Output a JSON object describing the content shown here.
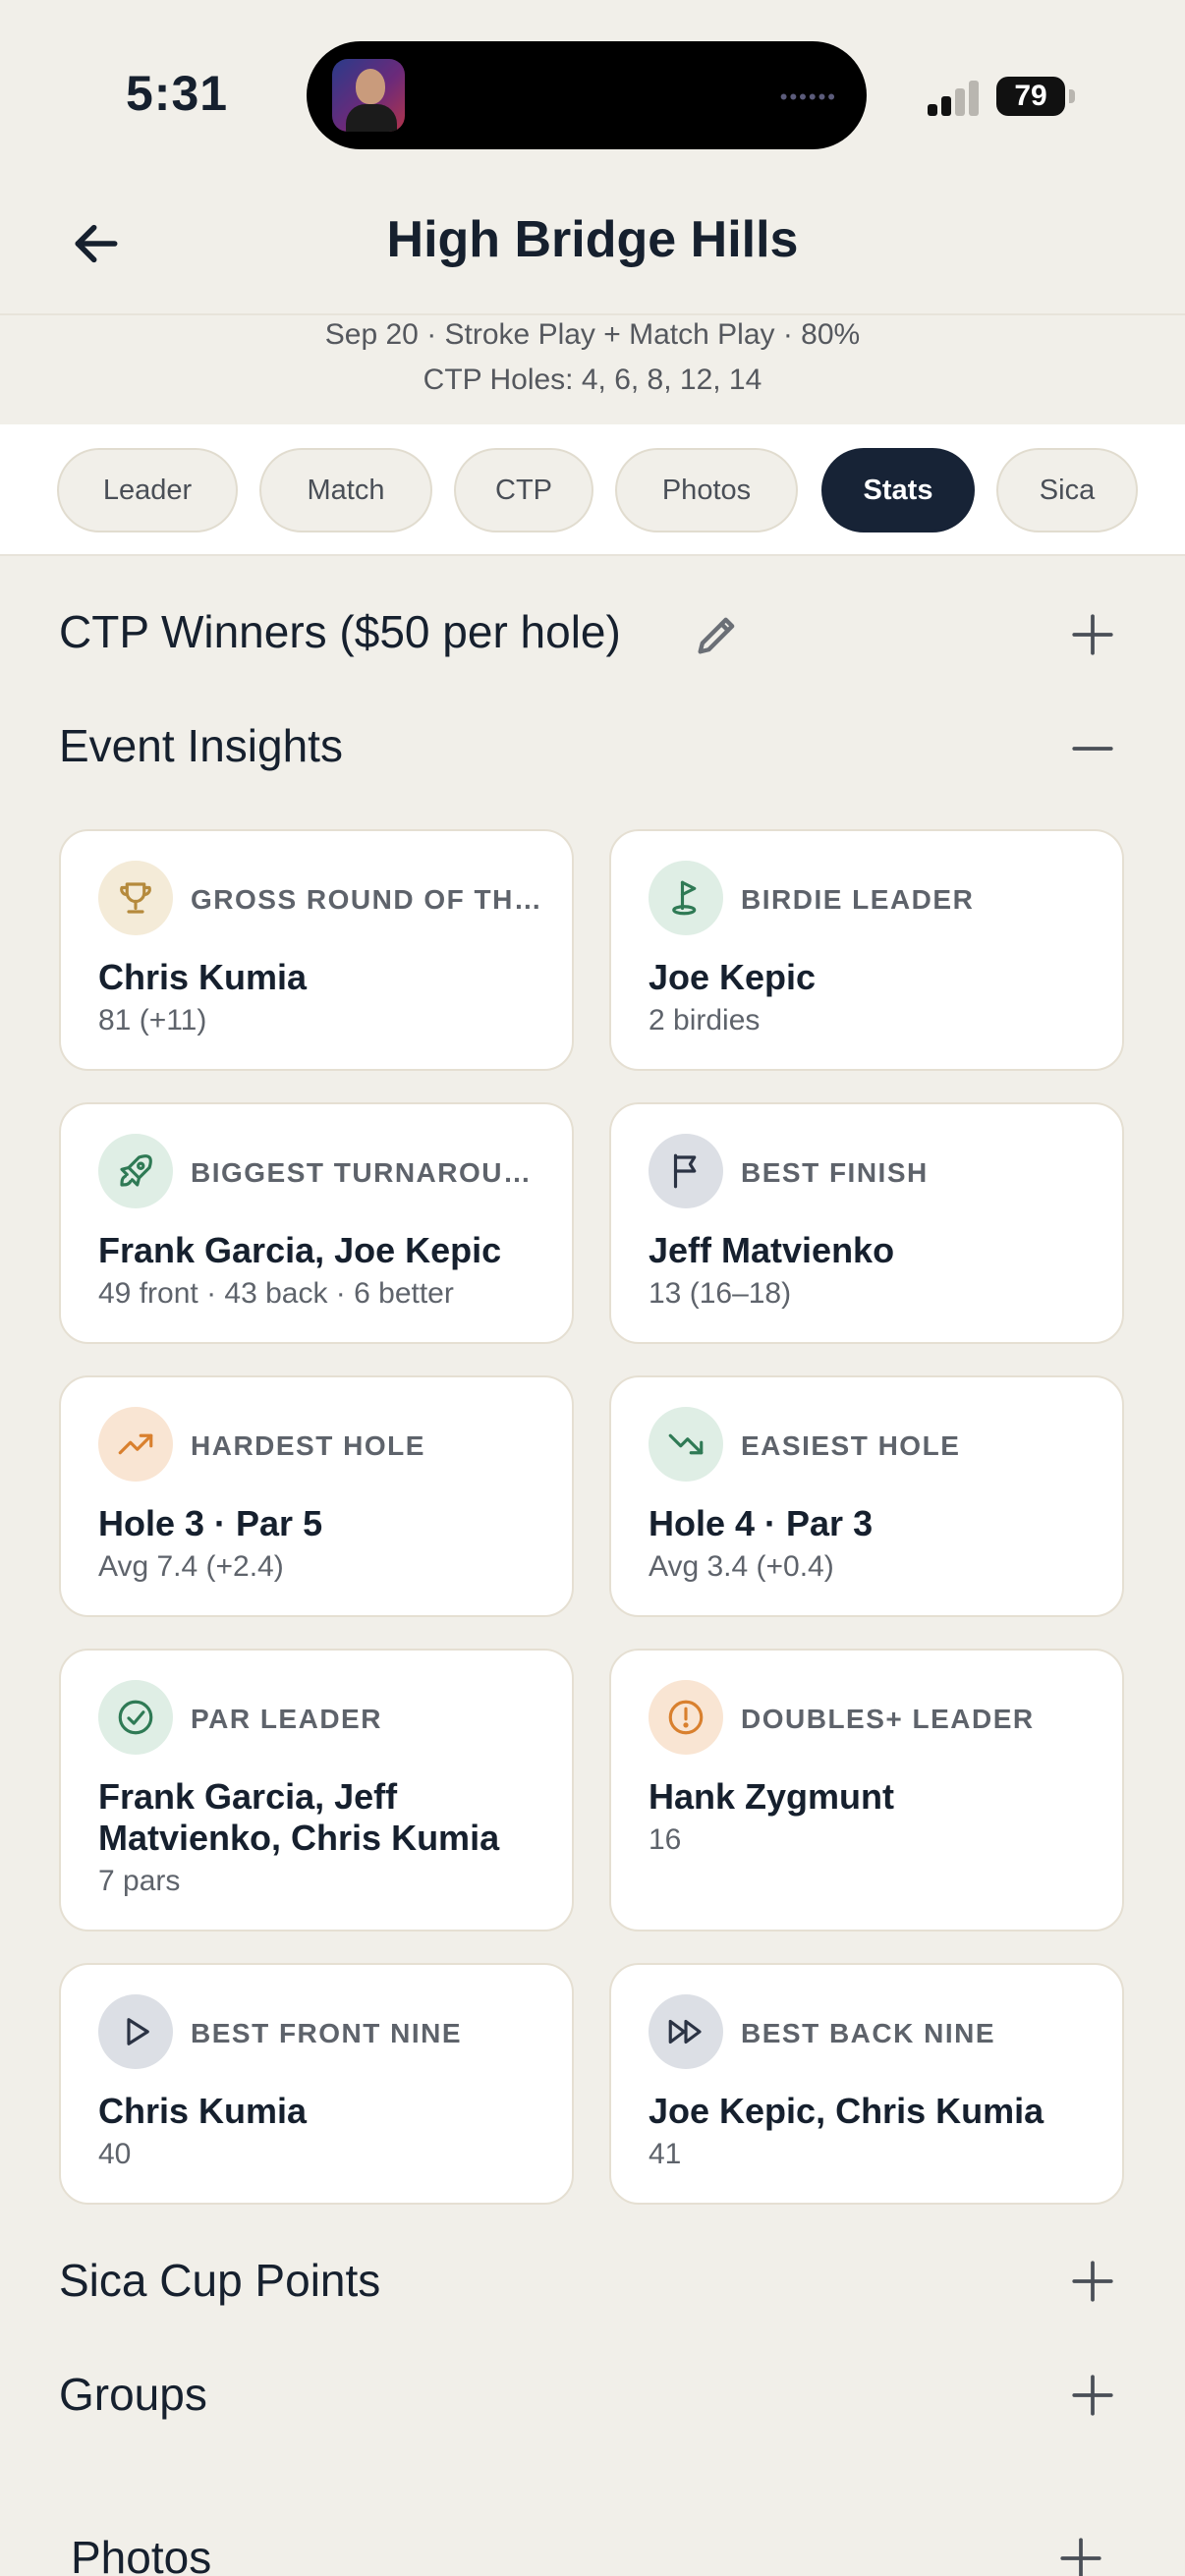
{
  "status": {
    "time": "5:31",
    "battery": "79"
  },
  "header": {
    "title": "High Bridge Hills",
    "subtitle": "Sep 20 · Stroke Play + Match Play · 80%",
    "ctp_holes": "CTP Holes: 4, 6, 8, 12, 14"
  },
  "tabs": [
    {
      "label": "Leader"
    },
    {
      "label": "Match"
    },
    {
      "label": "CTP"
    },
    {
      "label": "Photos"
    },
    {
      "label": "Stats",
      "active": true
    },
    {
      "label": "Sica"
    }
  ],
  "sections": {
    "ctp": {
      "title": "CTP Winners ($50 per hole)",
      "state": "collapsed"
    },
    "insights": {
      "title": "Event Insights",
      "state": "expanded"
    },
    "sica": {
      "title": "Sica Cup Points",
      "state": "collapsed"
    },
    "groups": {
      "title": "Groups",
      "state": "collapsed"
    },
    "photos": {
      "title": "Photos",
      "state": "collapsed"
    }
  },
  "insights": [
    {
      "icon": "trophy-icon",
      "label": "GROSS ROUND OF THE DAY",
      "name": "Chris Kumia",
      "detail": "81 (+11)"
    },
    {
      "icon": "golf-flag-icon",
      "label": "BIRDIE LEADER",
      "name": "Joe Kepic",
      "detail": "2 birdies"
    },
    {
      "icon": "rocket-icon",
      "label": "BIGGEST TURNAROUND",
      "name": "Frank Garcia, Joe Kepic",
      "detail": "49 front · 43 back · 6 better"
    },
    {
      "icon": "flag-icon",
      "label": "BEST FINISH",
      "name": "Jeff Matvienko",
      "detail": "13 (16–18)"
    },
    {
      "icon": "trending-up-icon",
      "label": "HARDEST HOLE",
      "name": "Hole 3 · Par 5",
      "detail": "Avg 7.4 (+2.4)"
    },
    {
      "icon": "trending-down-icon",
      "label": "EASIEST HOLE",
      "name": "Hole 4 · Par 3",
      "detail": "Avg 3.4 (+0.4)"
    },
    {
      "icon": "check-circle-icon",
      "label": "PAR LEADER",
      "name": "Frank Garcia, Jeff Matvienko, Chris Kumia",
      "detail": "7 pars"
    },
    {
      "icon": "alert-circle-icon",
      "label": "DOUBLES+ LEADER",
      "name": "Hank Zygmunt",
      "detail": "16"
    },
    {
      "icon": "play-icon",
      "label": "BEST FRONT NINE",
      "name": "Chris Kumia",
      "detail": "40"
    },
    {
      "icon": "fast-forward-icon",
      "label": "BEST BACK NINE",
      "name": "Joe Kepic, Chris Kumia",
      "detail": "41"
    }
  ],
  "colors": {
    "background": "#f1efe9",
    "navy": "#172336",
    "gold": "#b58a3c",
    "green": "#2f7a55",
    "orange": "#d9802e",
    "slate": "#2b3344"
  }
}
